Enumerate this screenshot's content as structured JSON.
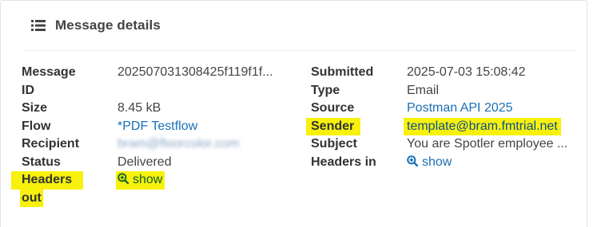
{
  "panel": {
    "title": "Message details",
    "title_icon": "list-icon"
  },
  "left": {
    "message_id": {
      "label_line1": "Message",
      "label_line2": "ID",
      "value": "202507031308425f119f1f..."
    },
    "size": {
      "label": "Size",
      "value": "8.45 kB"
    },
    "flow": {
      "label": "Flow",
      "value": "*PDF Testflow"
    },
    "recipient": {
      "label": "Recipient",
      "value": "bram@floorcolor.com"
    },
    "status": {
      "label": "Status",
      "value": "Delivered"
    },
    "headers_out": {
      "label_line1": "Headers",
      "label_line2": "out",
      "value": "show",
      "icon": "zoom-in-icon"
    }
  },
  "right": {
    "submitted": {
      "label": "Submitted",
      "value": "2025-07-03 15:08:42"
    },
    "type": {
      "label": "Type",
      "value": "Email"
    },
    "source": {
      "label": "Source",
      "value": "Postman API 2025"
    },
    "sender": {
      "label": "Sender",
      "value": "template@bram.fmtrial.net"
    },
    "subject": {
      "label": "Subject",
      "value": "You are Spotler employee ..."
    },
    "headers_in": {
      "label": "Headers in",
      "value": "show",
      "icon": "zoom-in-icon"
    }
  },
  "colors": {
    "link": "#1a6fb5",
    "highlight": "#f7f10c",
    "label": "#333333"
  }
}
